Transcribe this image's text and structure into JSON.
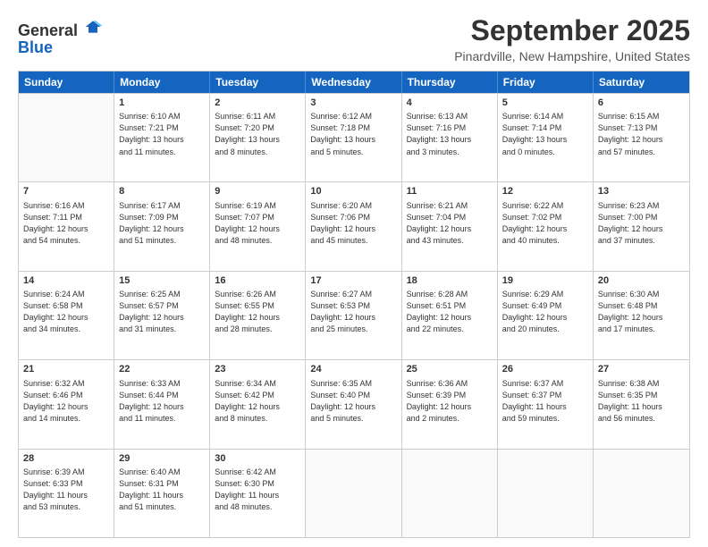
{
  "logo": {
    "line1": "General",
    "line2": "Blue"
  },
  "title": "September 2025",
  "location": "Pinardville, New Hampshire, United States",
  "headers": [
    "Sunday",
    "Monday",
    "Tuesday",
    "Wednesday",
    "Thursday",
    "Friday",
    "Saturday"
  ],
  "rows": [
    [
      {
        "day": "",
        "lines": []
      },
      {
        "day": "1",
        "lines": [
          "Sunrise: 6:10 AM",
          "Sunset: 7:21 PM",
          "Daylight: 13 hours",
          "and 11 minutes."
        ]
      },
      {
        "day": "2",
        "lines": [
          "Sunrise: 6:11 AM",
          "Sunset: 7:20 PM",
          "Daylight: 13 hours",
          "and 8 minutes."
        ]
      },
      {
        "day": "3",
        "lines": [
          "Sunrise: 6:12 AM",
          "Sunset: 7:18 PM",
          "Daylight: 13 hours",
          "and 5 minutes."
        ]
      },
      {
        "day": "4",
        "lines": [
          "Sunrise: 6:13 AM",
          "Sunset: 7:16 PM",
          "Daylight: 13 hours",
          "and 3 minutes."
        ]
      },
      {
        "day": "5",
        "lines": [
          "Sunrise: 6:14 AM",
          "Sunset: 7:14 PM",
          "Daylight: 13 hours",
          "and 0 minutes."
        ]
      },
      {
        "day": "6",
        "lines": [
          "Sunrise: 6:15 AM",
          "Sunset: 7:13 PM",
          "Daylight: 12 hours",
          "and 57 minutes."
        ]
      }
    ],
    [
      {
        "day": "7",
        "lines": [
          "Sunrise: 6:16 AM",
          "Sunset: 7:11 PM",
          "Daylight: 12 hours",
          "and 54 minutes."
        ]
      },
      {
        "day": "8",
        "lines": [
          "Sunrise: 6:17 AM",
          "Sunset: 7:09 PM",
          "Daylight: 12 hours",
          "and 51 minutes."
        ]
      },
      {
        "day": "9",
        "lines": [
          "Sunrise: 6:19 AM",
          "Sunset: 7:07 PM",
          "Daylight: 12 hours",
          "and 48 minutes."
        ]
      },
      {
        "day": "10",
        "lines": [
          "Sunrise: 6:20 AM",
          "Sunset: 7:06 PM",
          "Daylight: 12 hours",
          "and 45 minutes."
        ]
      },
      {
        "day": "11",
        "lines": [
          "Sunrise: 6:21 AM",
          "Sunset: 7:04 PM",
          "Daylight: 12 hours",
          "and 43 minutes."
        ]
      },
      {
        "day": "12",
        "lines": [
          "Sunrise: 6:22 AM",
          "Sunset: 7:02 PM",
          "Daylight: 12 hours",
          "and 40 minutes."
        ]
      },
      {
        "day": "13",
        "lines": [
          "Sunrise: 6:23 AM",
          "Sunset: 7:00 PM",
          "Daylight: 12 hours",
          "and 37 minutes."
        ]
      }
    ],
    [
      {
        "day": "14",
        "lines": [
          "Sunrise: 6:24 AM",
          "Sunset: 6:58 PM",
          "Daylight: 12 hours",
          "and 34 minutes."
        ]
      },
      {
        "day": "15",
        "lines": [
          "Sunrise: 6:25 AM",
          "Sunset: 6:57 PM",
          "Daylight: 12 hours",
          "and 31 minutes."
        ]
      },
      {
        "day": "16",
        "lines": [
          "Sunrise: 6:26 AM",
          "Sunset: 6:55 PM",
          "Daylight: 12 hours",
          "and 28 minutes."
        ]
      },
      {
        "day": "17",
        "lines": [
          "Sunrise: 6:27 AM",
          "Sunset: 6:53 PM",
          "Daylight: 12 hours",
          "and 25 minutes."
        ]
      },
      {
        "day": "18",
        "lines": [
          "Sunrise: 6:28 AM",
          "Sunset: 6:51 PM",
          "Daylight: 12 hours",
          "and 22 minutes."
        ]
      },
      {
        "day": "19",
        "lines": [
          "Sunrise: 6:29 AM",
          "Sunset: 6:49 PM",
          "Daylight: 12 hours",
          "and 20 minutes."
        ]
      },
      {
        "day": "20",
        "lines": [
          "Sunrise: 6:30 AM",
          "Sunset: 6:48 PM",
          "Daylight: 12 hours",
          "and 17 minutes."
        ]
      }
    ],
    [
      {
        "day": "21",
        "lines": [
          "Sunrise: 6:32 AM",
          "Sunset: 6:46 PM",
          "Daylight: 12 hours",
          "and 14 minutes."
        ]
      },
      {
        "day": "22",
        "lines": [
          "Sunrise: 6:33 AM",
          "Sunset: 6:44 PM",
          "Daylight: 12 hours",
          "and 11 minutes."
        ]
      },
      {
        "day": "23",
        "lines": [
          "Sunrise: 6:34 AM",
          "Sunset: 6:42 PM",
          "Daylight: 12 hours",
          "and 8 minutes."
        ]
      },
      {
        "day": "24",
        "lines": [
          "Sunrise: 6:35 AM",
          "Sunset: 6:40 PM",
          "Daylight: 12 hours",
          "and 5 minutes."
        ]
      },
      {
        "day": "25",
        "lines": [
          "Sunrise: 6:36 AM",
          "Sunset: 6:39 PM",
          "Daylight: 12 hours",
          "and 2 minutes."
        ]
      },
      {
        "day": "26",
        "lines": [
          "Sunrise: 6:37 AM",
          "Sunset: 6:37 PM",
          "Daylight: 11 hours",
          "and 59 minutes."
        ]
      },
      {
        "day": "27",
        "lines": [
          "Sunrise: 6:38 AM",
          "Sunset: 6:35 PM",
          "Daylight: 11 hours",
          "and 56 minutes."
        ]
      }
    ],
    [
      {
        "day": "28",
        "lines": [
          "Sunrise: 6:39 AM",
          "Sunset: 6:33 PM",
          "Daylight: 11 hours",
          "and 53 minutes."
        ]
      },
      {
        "day": "29",
        "lines": [
          "Sunrise: 6:40 AM",
          "Sunset: 6:31 PM",
          "Daylight: 11 hours",
          "and 51 minutes."
        ]
      },
      {
        "day": "30",
        "lines": [
          "Sunrise: 6:42 AM",
          "Sunset: 6:30 PM",
          "Daylight: 11 hours",
          "and 48 minutes."
        ]
      },
      {
        "day": "",
        "lines": []
      },
      {
        "day": "",
        "lines": []
      },
      {
        "day": "",
        "lines": []
      },
      {
        "day": "",
        "lines": []
      }
    ]
  ]
}
